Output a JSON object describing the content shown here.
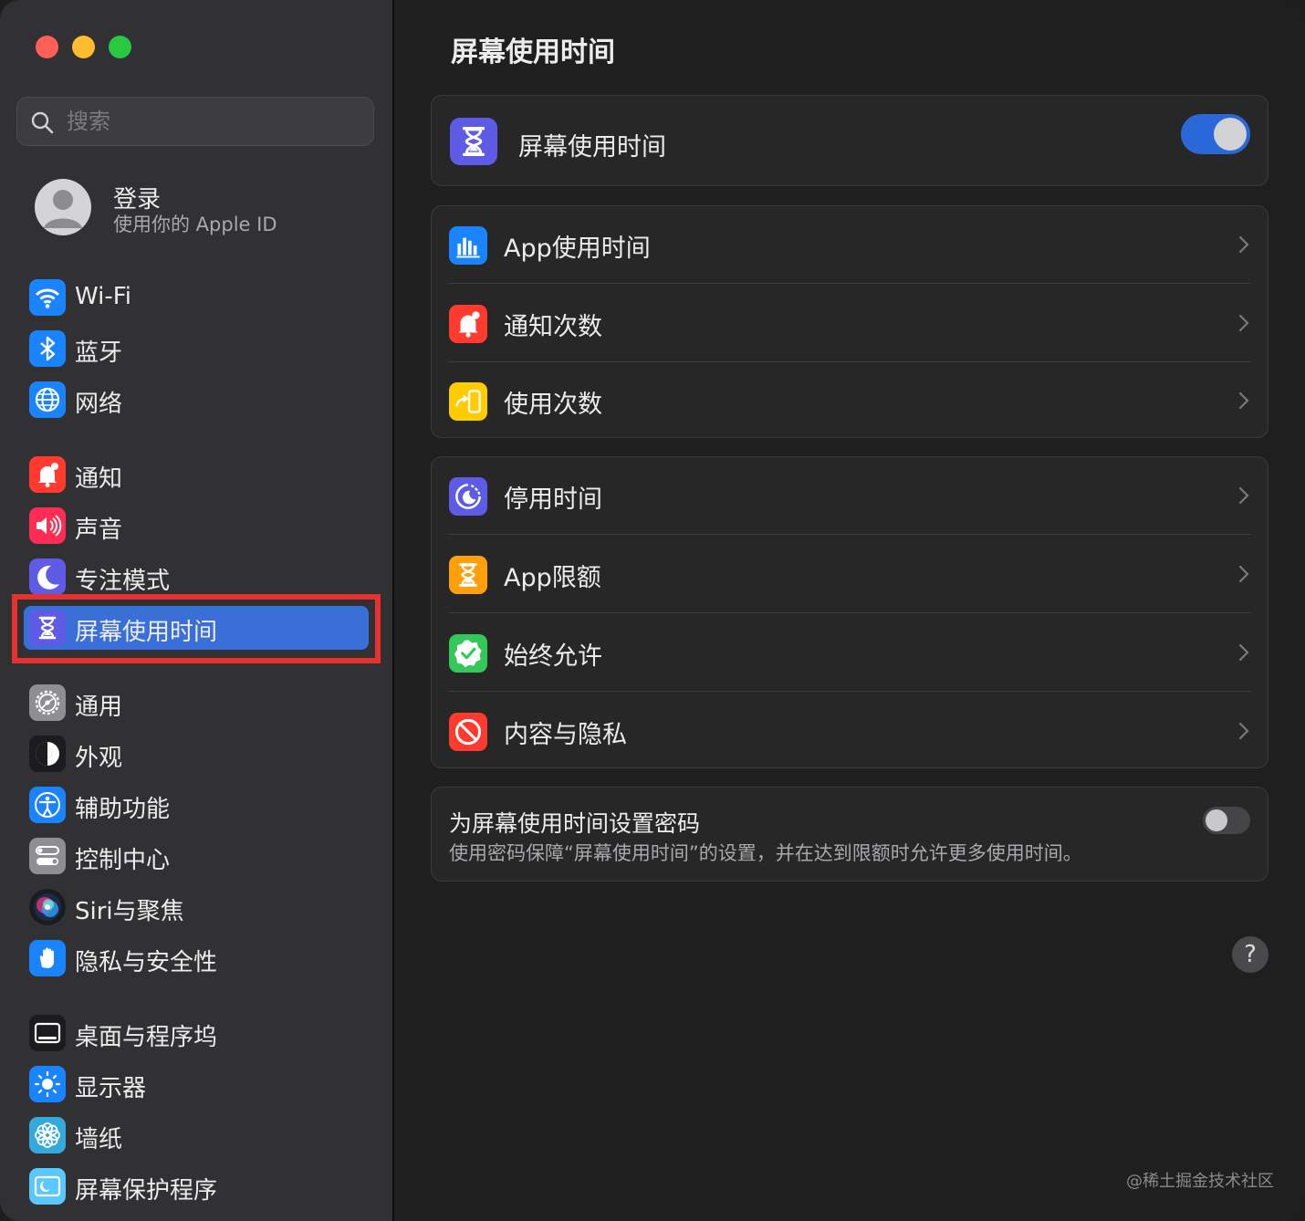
{
  "window": {
    "controls": [
      "close",
      "minimize",
      "zoom"
    ]
  },
  "sidebar": {
    "search": {
      "placeholder": "搜索"
    },
    "account": {
      "title": "登录",
      "subtitle": "使用你的 Apple ID"
    },
    "items": [
      {
        "label": "Wi-Fi",
        "icon": "wifi-icon",
        "color": "#1a84ff"
      },
      {
        "label": "蓝牙",
        "icon": "bluetooth-icon",
        "color": "#1a84ff"
      },
      {
        "label": "网络",
        "icon": "globe-icon",
        "color": "#1a84ff"
      },
      {
        "label": "通知",
        "icon": "bell-icon",
        "color": "#ff3b30"
      },
      {
        "label": "声音",
        "icon": "speaker-icon",
        "color": "#ff2d55"
      },
      {
        "label": "专注模式",
        "icon": "moon-icon",
        "color": "#5e5ce6"
      },
      {
        "label": "屏幕使用时间",
        "icon": "hourglass-icon",
        "color": "#5e5ce6",
        "selected": true
      },
      {
        "label": "通用",
        "icon": "gear-icon",
        "color": "#8e8e93"
      },
      {
        "label": "外观",
        "icon": "appearance-icon",
        "color": "#1c1c1e"
      },
      {
        "label": "辅助功能",
        "icon": "accessibility-icon",
        "color": "#1a84ff"
      },
      {
        "label": "控制中心",
        "icon": "control-center-icon",
        "color": "#8e8e93"
      },
      {
        "label": "Siri与聚焦",
        "icon": "siri-icon",
        "color": "#2a2a2e"
      },
      {
        "label": "隐私与安全性",
        "icon": "hand-icon",
        "color": "#1a84ff"
      },
      {
        "label": "桌面与程序坞",
        "icon": "dock-icon",
        "color": "#1c1c1e"
      },
      {
        "label": "显示器",
        "icon": "sun-icon",
        "color": "#1a84ff"
      },
      {
        "label": "墙纸",
        "icon": "flower-icon",
        "color": "#34aadc"
      },
      {
        "label": "屏幕保护程序",
        "icon": "screensaver-icon",
        "color": "#5ac8fa"
      }
    ]
  },
  "main": {
    "title": "屏幕使用时间",
    "screen_time_toggle": {
      "label": "屏幕使用时间",
      "on": true
    },
    "group1": [
      {
        "label": "App使用时间",
        "icon": "bar-chart-icon"
      },
      {
        "label": "通知次数",
        "icon": "bell-icon"
      },
      {
        "label": "使用次数",
        "icon": "pickup-icon"
      }
    ],
    "group2": [
      {
        "label": "停用时间",
        "icon": "downtime-icon"
      },
      {
        "label": "App限额",
        "icon": "hourglass-icon"
      },
      {
        "label": "始终允许",
        "icon": "checkmark-badge-icon"
      },
      {
        "label": "内容与隐私",
        "icon": "no-entry-icon"
      }
    ],
    "passcode": {
      "title": "为屏幕使用时间设置密码",
      "description": "使用密码保障“屏幕使用时间”的设置，并在达到限额时允许更多使用时间。",
      "on": false
    },
    "help": "?",
    "watermark": "@稀土掘金技术社区"
  },
  "colors": {
    "accent": "#2a68d9",
    "highlight": "#e8302e",
    "selected_row": "#3a6fd8"
  }
}
